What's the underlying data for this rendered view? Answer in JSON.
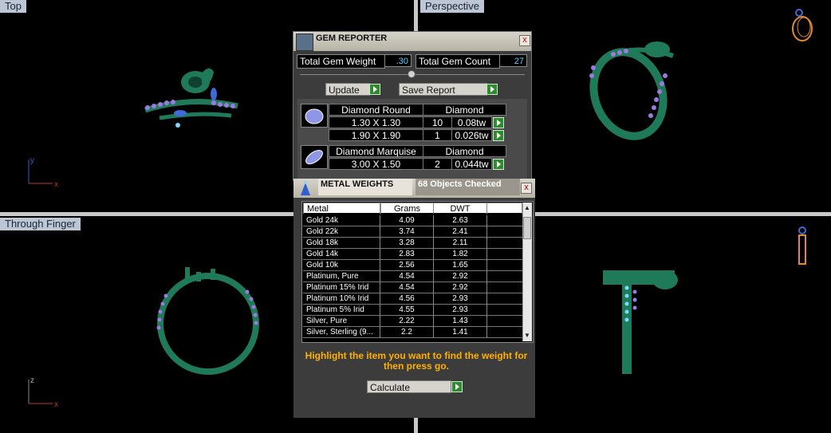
{
  "viewports": {
    "top": "Top",
    "perspective": "Perspective",
    "through_finger": "Through Finger"
  },
  "axes": {
    "top_y": "y",
    "top_x": "x",
    "front_z": "z",
    "front_x": "x"
  },
  "gem_reporter": {
    "title": "GEM REPORTER",
    "close": "x",
    "total_weight_label": "Total Gem Weight",
    "total_weight_value": ".30",
    "total_count_label": "Total Gem Count",
    "total_count_value": "27",
    "update_label": "Update",
    "save_report_label": "Save Report",
    "gems": [
      {
        "shape": "Diamond Round",
        "material": "Diamond",
        "rows": [
          {
            "size": "1.30 X 1.30",
            "count": "10",
            "weight": "0.08tw"
          },
          {
            "size": "1.90 X 1.90",
            "count": "1",
            "weight": "0.026tw"
          }
        ]
      },
      {
        "shape": "Diamond Marquise",
        "material": "Diamond",
        "rows": [
          {
            "size": "3.00 X 1.50",
            "count": "2",
            "weight": "0.044tw"
          }
        ]
      }
    ]
  },
  "metal_weights": {
    "title": "METAL WEIGHTS",
    "objects_checked": "68 Objects Checked",
    "close": "x",
    "headers": [
      "Metal",
      "Grams",
      "DWT"
    ],
    "rows": [
      [
        "Gold 24k",
        "4.09",
        "2.63"
      ],
      [
        "Gold 22k",
        "3.74",
        "2.41"
      ],
      [
        "Gold 18k",
        "3.28",
        "2.11"
      ],
      [
        "Gold 14k",
        "2.83",
        "1.82"
      ],
      [
        "Gold 10k",
        "2.56",
        "1.65"
      ],
      [
        "Platinum, Pure",
        "4.54",
        "2.92"
      ],
      [
        "Platinum 15% Irid",
        "4.54",
        "2.92"
      ],
      [
        "Platinum 10% Irid",
        "4.56",
        "2.93"
      ],
      [
        "Platinum 5% Irid",
        "4.55",
        "2.93"
      ],
      [
        "Silver, Pure",
        "2.22",
        "1.43"
      ],
      [
        "Silver, Sterling (9...",
        "2.2",
        "1.41"
      ]
    ],
    "instruction": "Highlight the item you want to find the weight for then press go.",
    "calculate_label": "Calculate"
  },
  "colors": {
    "ring_green": "#1f7a5a",
    "stone_purple": "#9b7be0",
    "stone_blue": "#7fd6ff",
    "axis_red": "#c0392b",
    "axis_blue": "#2f5fd0",
    "highlight": "#ffb000"
  }
}
